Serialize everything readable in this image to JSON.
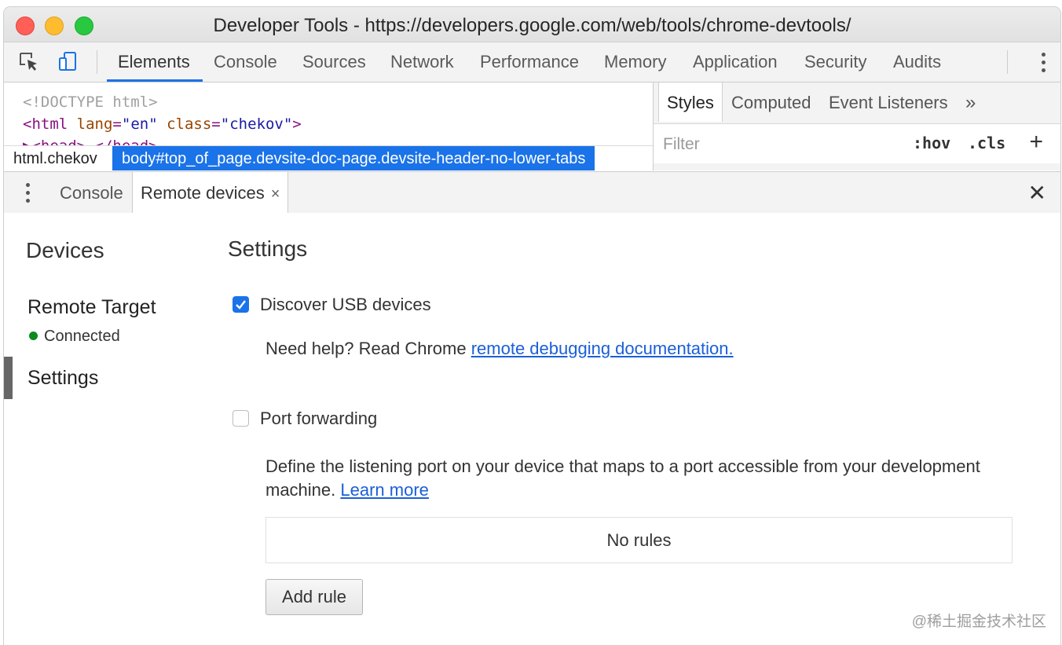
{
  "window": {
    "title": "Developer Tools - https://developers.google.com/web/tools/chrome-devtools/"
  },
  "toolbar": {
    "tabs": [
      "Elements",
      "Console",
      "Sources",
      "Network",
      "Performance",
      "Memory",
      "Application",
      "Security",
      "Audits"
    ],
    "active_tab": "Elements"
  },
  "elements": {
    "lines": {
      "doctype": "<!DOCTYPE html>",
      "html_open": "<html",
      "attr_lang": "lang",
      "val_lang": "\"en\"",
      "attr_class": "class",
      "val_class": "\"chekov\"",
      "html_close": ">",
      "head": "▶<head>…</head>"
    },
    "breadcrumbs": [
      "html.chekov",
      "body#top_of_page.devsite-doc-page.devsite-header-no-lower-tabs"
    ]
  },
  "styles_pane": {
    "tabs": [
      "Styles",
      "Computed",
      "Event Listeners"
    ],
    "overflow": "»",
    "filter_placeholder": "Filter",
    "hov": ":hov",
    "cls": ".cls",
    "plus": "+"
  },
  "drawer": {
    "tabs": [
      "Console",
      "Remote devices"
    ],
    "active_tab": "Remote devices",
    "tab_close": "×",
    "close": "✕"
  },
  "sidebar": {
    "title": "Devices",
    "remote_target": "Remote Target",
    "status": "Connected",
    "settings": "Settings"
  },
  "settings": {
    "title": "Settings",
    "discover_usb": {
      "label": "Discover USB devices",
      "checked": true
    },
    "help_prefix": "Need help? Read Chrome ",
    "help_link": "remote debugging documentation.",
    "port_forwarding": {
      "label": "Port forwarding",
      "checked": false
    },
    "pf_desc": "Define the listening port on your device that maps to a port accessible from your development machine. ",
    "learn_more": "Learn more",
    "no_rules": "No rules",
    "add_rule": "Add rule"
  },
  "watermark": "@稀土掘金技术社区",
  "colors": {
    "accent": "#1a73e8",
    "link": "#1a5fd9",
    "connected": "#0a8a1f"
  }
}
